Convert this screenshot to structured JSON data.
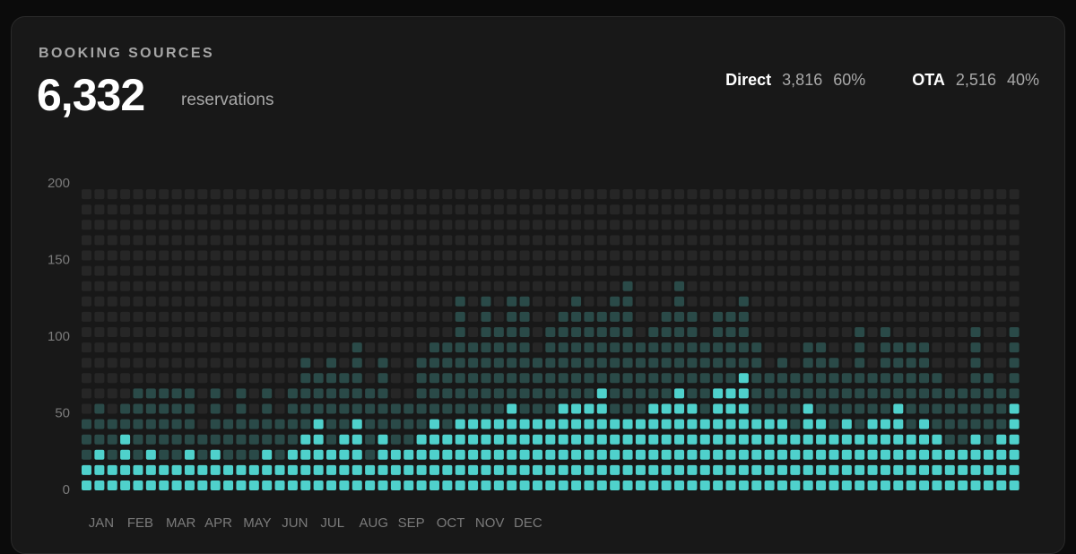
{
  "card": {
    "title": "BOOKING SOURCES",
    "total": "6,332",
    "total_unit": "reservations"
  },
  "legend": [
    {
      "name": "Direct",
      "value": "3,816",
      "percent": "60%",
      "color": "#4fd1cc"
    },
    {
      "name": "OTA",
      "value": "2,516",
      "percent": "40%",
      "color": "#2a4a48"
    }
  ],
  "colors": {
    "direct": "#4fd1cc",
    "ota": "#2a4a48",
    "empty": "#262626",
    "background": "#181818"
  },
  "chart_data": {
    "type": "bar",
    "subtype": "stacked-waffle",
    "y_ticks": [
      "200",
      "150",
      "100",
      "50",
      "0"
    ],
    "ylim": [
      0,
      200
    ],
    "unit_per_cell": 10,
    "x_labels": [
      "JAN",
      "FEB",
      "MAR",
      "APR",
      "MAY",
      "JUN",
      "JUL",
      "AUG",
      "SEP",
      "OCT",
      "NOV",
      "DEC"
    ],
    "bars_per_month": 3,
    "series": [
      {
        "name": "Direct",
        "values": [
          20,
          30,
          20,
          40,
          20,
          30,
          20,
          20,
          30,
          20,
          30,
          20,
          20,
          20,
          30,
          20,
          30,
          40,
          50,
          30,
          40,
          50,
          20,
          40,
          30,
          30,
          40,
          50,
          40,
          50,
          50,
          50,
          50,
          60,
          50,
          50,
          50,
          60,
          60,
          60,
          70,
          50,
          50,
          50,
          60,
          60,
          70,
          60,
          50,
          70,
          70,
          80,
          50,
          50,
          50,
          40,
          60,
          50,
          40,
          50,
          40,
          50,
          50,
          60,
          40,
          50,
          40,
          30,
          30,
          40,
          30,
          40,
          60
        ]
      },
      {
        "name": "OTA",
        "values": [
          30,
          30,
          30,
          20,
          50,
          40,
          50,
          50,
          40,
          20,
          40,
          30,
          50,
          30,
          40,
          30,
          40,
          50,
          30,
          60,
          40,
          50,
          50,
          50,
          30,
          30,
          50,
          50,
          60,
          80,
          50,
          80,
          60,
          70,
          80,
          40,
          60,
          60,
          70,
          60,
          50,
          80,
          90,
          50,
          50,
          60,
          70,
          60,
          50,
          50,
          50,
          50,
          50,
          30,
          40,
          40,
          40,
          50,
          50,
          30,
          70,
          30,
          60,
          40,
          60,
          50,
          40,
          40,
          40,
          70,
          50,
          30,
          50
        ]
      }
    ]
  }
}
